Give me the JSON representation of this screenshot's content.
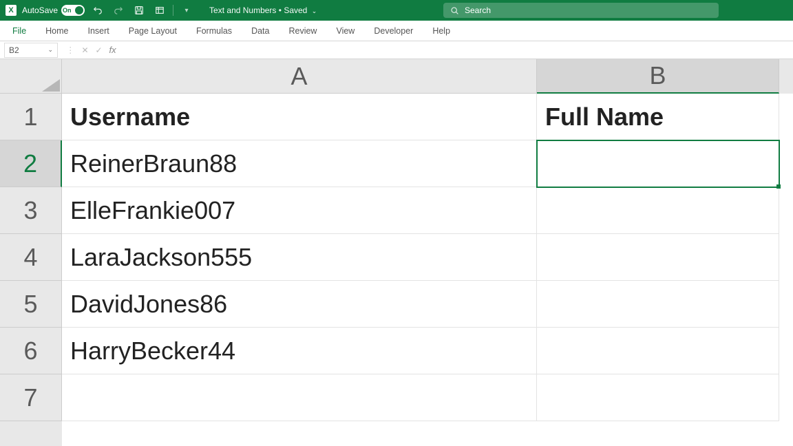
{
  "titlebar": {
    "autosave_label": "AutoSave",
    "toggle_state": "On",
    "doc_name": "Text and Numbers",
    "save_status": "Saved",
    "search_placeholder": "Search"
  },
  "ribbon": {
    "tabs": [
      "File",
      "Home",
      "Insert",
      "Page Layout",
      "Formulas",
      "Data",
      "Review",
      "View",
      "Developer",
      "Help"
    ]
  },
  "formula_bar": {
    "name_box": "B2",
    "formula": ""
  },
  "columns": [
    "A",
    "B"
  ],
  "row_numbers": [
    "1",
    "2",
    "3",
    "4",
    "5",
    "6",
    "7"
  ],
  "selected_cell": {
    "row": 2,
    "col": "B"
  },
  "data": {
    "headers": {
      "A": "Username",
      "B": "Full Name"
    },
    "rows": [
      {
        "A": "ReinerBraun88",
        "B": ""
      },
      {
        "A": "ElleFrankie007",
        "B": ""
      },
      {
        "A": "LaraJackson555",
        "B": ""
      },
      {
        "A": "DavidJones86",
        "B": ""
      },
      {
        "A": "HarryBecker44",
        "B": ""
      },
      {
        "A": "",
        "B": ""
      }
    ]
  }
}
